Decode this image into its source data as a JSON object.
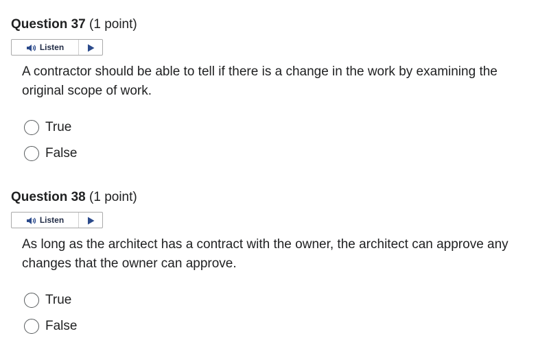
{
  "questions": [
    {
      "title": "Question 37",
      "points": "(1 point)",
      "listen_label": "Listen",
      "text": "A contractor should be able to tell if there is a change in the work by examining the original scope of work.",
      "options": [
        {
          "label": "True",
          "selected": false
        },
        {
          "label": "False",
          "selected": false
        }
      ]
    },
    {
      "title": "Question 38",
      "points": "(1 point)",
      "listen_label": "Listen",
      "text": "As long as the architect has a contract with the owner, the architect can approve any changes that the owner can approve.",
      "options": [
        {
          "label": "True",
          "selected": false
        },
        {
          "label": "False",
          "selected": false
        }
      ]
    }
  ],
  "colors": {
    "text": "#202122",
    "listen_text": "#1f2a44",
    "speaker_icon": "#2b4a8b",
    "radio_border": "#565a5c"
  },
  "icons": {
    "listen": "speaker-icon",
    "play": "play-icon"
  }
}
